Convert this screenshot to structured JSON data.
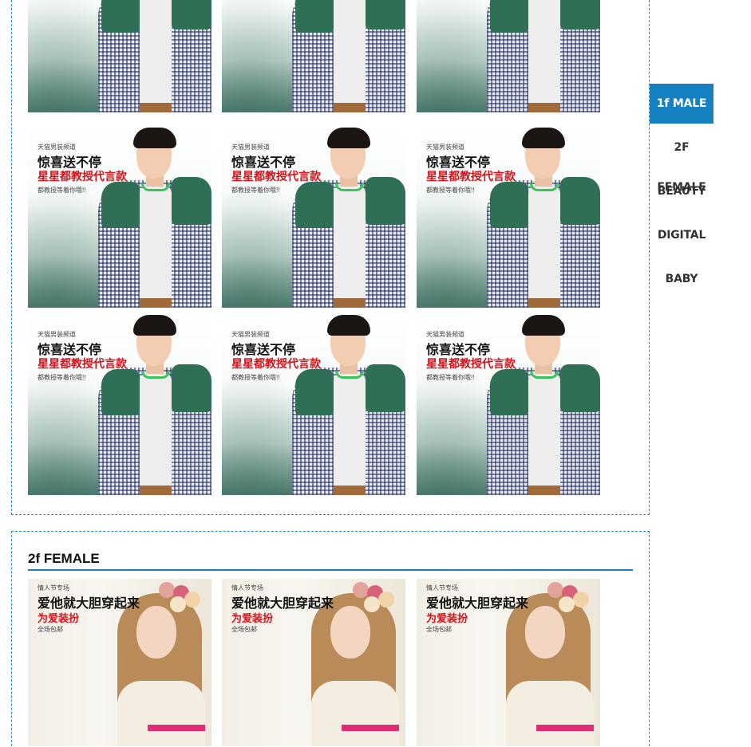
{
  "floors": [
    {
      "id": "male",
      "title": "1f MALE",
      "tile_text": {
        "line1": "天猫男装频道",
        "line2": "惊喜送不停",
        "line3": "星星都教授代言款",
        "line4": "都教授等着你哦!!"
      }
    },
    {
      "id": "female",
      "title": "2f FEMALE",
      "tile_text": {
        "line1": "情人节专场",
        "line2": "爱他就大胆穿起来",
        "line3": "为爱装扮",
        "line4": "全场包邮"
      }
    }
  ],
  "floor_nav": {
    "items": [
      {
        "label": "1f MALE",
        "active": true
      },
      {
        "label": "2F FEMALE",
        "active": false
      },
      {
        "label": "BEAUTY",
        "active": false
      },
      {
        "label": "DIGITAL",
        "active": false
      },
      {
        "label": "BABY",
        "active": false
      }
    ]
  },
  "colors": {
    "accent": "#1581c0",
    "promo_red": "#d0141d",
    "border": "#2b8bbf"
  }
}
